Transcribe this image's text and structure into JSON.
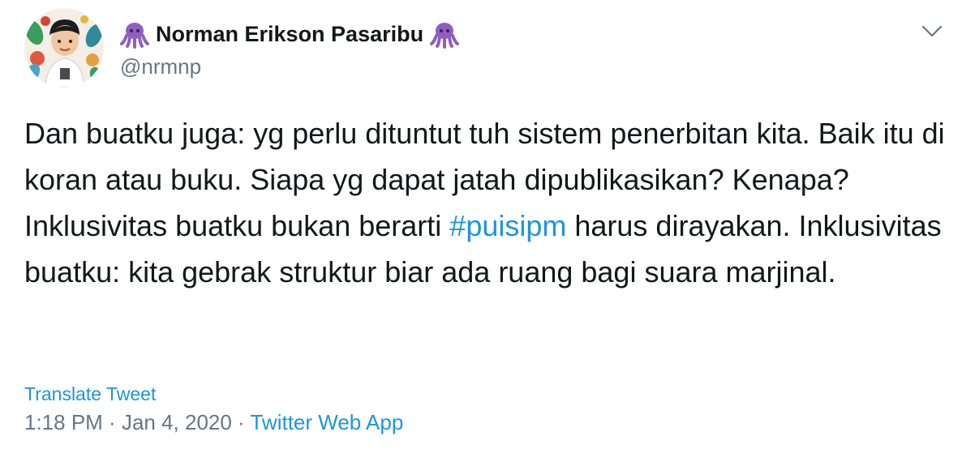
{
  "tweet": {
    "author": {
      "display_name": "Norman Erikson Pasaribu",
      "handle": "@nrmnp",
      "emoji_left": "octopus-icon",
      "emoji_right": "octopus-icon"
    },
    "text_before_hashtag": "Dan buatku juga: yg perlu dituntut tuh sistem penerbitan kita. Baik itu di koran atau buku. Siapa yg dapat jatah dipublikasikan? Kenapa? Inklusivitas buatku bukan berarti ",
    "hashtag": "#puisipm",
    "text_after_hashtag": " harus dirayakan. Inklusivitas buatku: kita gebrak struktur biar ada ruang bagi suara marjinal.",
    "translate_label": "Translate Tweet",
    "time": "1:18 PM",
    "separator": " · ",
    "date": "Jan 4, 2020",
    "source_app": "Twitter Web App"
  },
  "colors": {
    "link": "#1b95e0",
    "secondary_text": "#657786",
    "primary_text": "#14171a",
    "emoji_purple": "#8e5ec1"
  }
}
